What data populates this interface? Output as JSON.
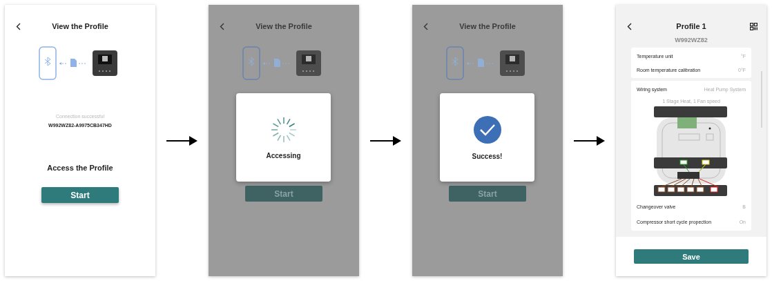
{
  "steps": [
    {
      "kind": "intro",
      "title": "View the Profile",
      "connection_status": "Connection successful",
      "device_id": "W992WZ82-A9975CB347HD",
      "heading": "Access the Profile",
      "button": "Start"
    },
    {
      "kind": "dialog",
      "title": "View the Profile",
      "button": "Start",
      "dialog": {
        "kind": "spinner",
        "message": "Accessing"
      }
    },
    {
      "kind": "dialog",
      "title": "View the Profile",
      "button": "Start",
      "dialog": {
        "kind": "check",
        "message": "Success!"
      }
    },
    {
      "kind": "profile",
      "title": "Profile 1",
      "serial": "W992WZ82",
      "settings": [
        {
          "label": "Temperature unit",
          "value": "°F"
        },
        {
          "label": "Room temperature calibration",
          "value": "0°F"
        }
      ],
      "wiring": {
        "label": "Wiring system",
        "value": "Heat Pump System",
        "caption": "1 Stage Heat, 1 Fan speed"
      },
      "more_settings": [
        {
          "label": "Changeover valve",
          "value": "B"
        },
        {
          "label": "Compressor short cycle propection",
          "value": "On"
        }
      ],
      "button": "Save"
    }
  ]
}
